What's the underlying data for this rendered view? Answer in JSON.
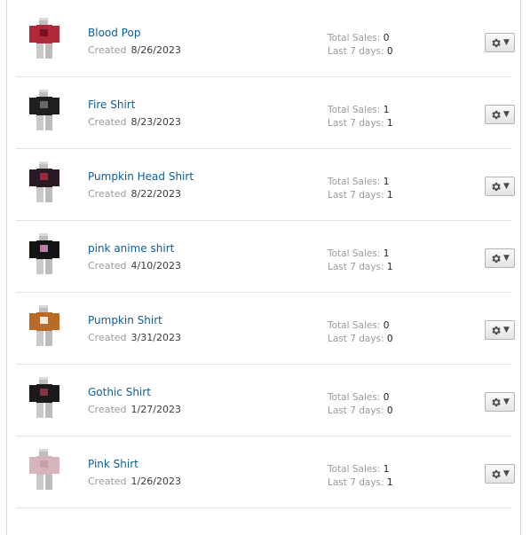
{
  "labels": {
    "created": "Created",
    "total_sales": "Total Sales:",
    "last_7_days": "Last 7 days:"
  },
  "items": [
    {
      "name": "Blood Pop",
      "created": "8/26/2023",
      "total_sales": "0",
      "last_7_days": "0",
      "body_color": "#b0283a",
      "accent": "#6a0f1c"
    },
    {
      "name": "Fire Shirt",
      "created": "8/23/2023",
      "total_sales": "1",
      "last_7_days": "1",
      "body_color": "#1e1e1e",
      "accent": "#777777"
    },
    {
      "name": "Pumpkin Head Shirt",
      "created": "8/22/2023",
      "total_sales": "1",
      "last_7_days": "1",
      "body_color": "#2a1a26",
      "accent": "#b8283a"
    },
    {
      "name": "pink anime shirt",
      "created": "4/10/2023",
      "total_sales": "1",
      "last_7_days": "1",
      "body_color": "#141414",
      "accent": "#d58ccf"
    },
    {
      "name": "Pumpkin Shirt",
      "created": "3/31/2023",
      "total_sales": "0",
      "last_7_days": "0",
      "body_color": "#b86a26",
      "accent": "#ffffff"
    },
    {
      "name": "Gothic Shirt",
      "created": "1/27/2023",
      "total_sales": "0",
      "last_7_days": "0",
      "body_color": "#1a1a1a",
      "accent": "#9a3a44"
    },
    {
      "name": "Pink Shirt",
      "created": "1/26/2023",
      "total_sales": "1",
      "last_7_days": "1",
      "body_color": "#d7b3ba",
      "accent": "#c99aa3"
    }
  ]
}
